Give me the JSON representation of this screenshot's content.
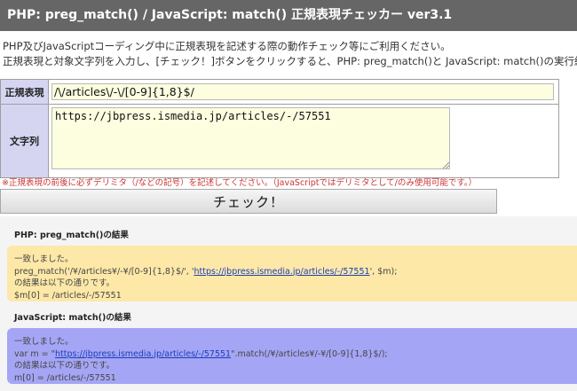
{
  "header": {
    "title": "PHP: preg_match() / JavaScript: match() 正規表現チェッカー ver3.1"
  },
  "description": {
    "line1": "PHP及びJavaScriptコーディング中に正規表現を記述する際の動作チェック等にご利用ください。",
    "line2": "正規表現と対象文字列を入力し、[チェック！]ボタンをクリックすると、PHP: preg_match()と JavaScript: match()の実行結果"
  },
  "form": {
    "regex_label": "正規表現",
    "regex_value": "/\\/articles\\/-\\/[0-9]{1,8}$/",
    "text_label": "文字列",
    "text_value": "https://jbpress.ismedia.jp/articles/-/57551",
    "note": "※正規表現の前後に必ずデリミタ（/などの記号）を記述してください。（JavaScriptではデリミタとして/のみ使用可能です。）",
    "check_button": "チェック！"
  },
  "php_result": {
    "heading": "PHP: preg_match()の結果",
    "line1": "一致しました。",
    "line2_prefix": "preg_match('/¥/articles¥/-¥/[0-9]{1,8}$/', '",
    "line2_link": "https://jbpress.ismedia.jp/articles/-/57551",
    "line2_suffix": "', $m);",
    "line3": "の結果は以下の通りです。",
    "line4": "$m[0] = /articles/-/57551"
  },
  "js_result": {
    "heading": "JavaScript: match()の結果",
    "line1": "一致しました。",
    "line2_prefix": "var m = \"",
    "line2_link": "https://jbpress.ismedia.jp/articles/-/57551",
    "line2_suffix": "\".match(/¥/articles¥/-¥/[0-9]{1,8}$/);",
    "line3": "の結果は以下の通りです。",
    "line4": "m[0] = /articles/-/57551"
  },
  "colors": {
    "header_bg": "#666666",
    "label_bg": "#d5d5f2",
    "input_bg": "#fdfde0",
    "note_color": "#cc3333",
    "php_box_bg": "#fde8a8",
    "js_box_bg": "#a5a5f5",
    "link_color": "#1a3fb8"
  }
}
